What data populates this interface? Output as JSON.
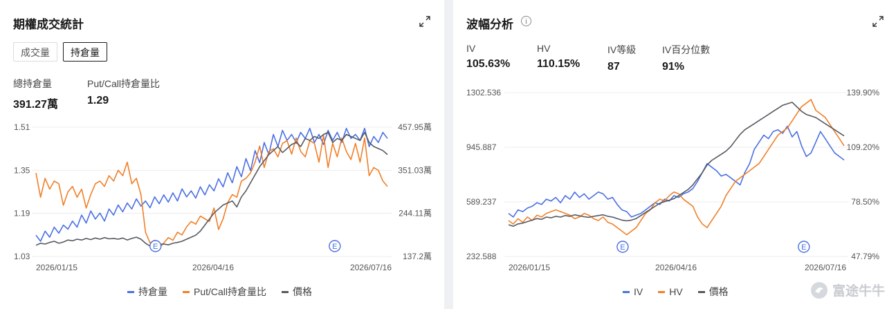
{
  "left": {
    "title": "期權成交統計",
    "tabs": [
      {
        "label": "成交量",
        "active": false
      },
      {
        "label": "持倉量",
        "active": true
      }
    ],
    "stats": [
      {
        "label": "總持倉量",
        "value": "391.27萬"
      },
      {
        "label": "Put/Call持倉量比",
        "value": "1.29"
      }
    ],
    "legend": [
      {
        "label": "持倉量",
        "color": "#4a6fe3"
      },
      {
        "label": "Put/Call持倉量比",
        "color": "#f07f28"
      },
      {
        "label": "價格",
        "color": "#55585e"
      }
    ],
    "event_marker": "E"
  },
  "right": {
    "title": "波幅分析",
    "info_icon": "i",
    "stats": [
      {
        "label": "IV",
        "value": "105.63%"
      },
      {
        "label": "HV",
        "value": "110.15%"
      },
      {
        "label": "IV等級",
        "value": "87"
      },
      {
        "label": "IV百分位數",
        "value": "91%"
      }
    ],
    "legend": [
      {
        "label": "IV",
        "color": "#4a6fe3"
      },
      {
        "label": "HV",
        "color": "#f07f28"
      },
      {
        "label": "價格",
        "color": "#55585e"
      }
    ],
    "event_marker": "E"
  },
  "watermark": "富途牛牛",
  "chart_data": [
    {
      "type": "line",
      "x": [
        "2026/01/15",
        "2026/04/16",
        "2026/07/16"
      ],
      "y_left_ticks": [
        "1.51",
        "1.35",
        "1.19",
        "1.03"
      ],
      "y_right_ticks": [
        "457.95萬",
        "351.03萬",
        "244.11萬",
        "137.2萬"
      ],
      "ylim_left": [
        1.03,
        1.51
      ],
      "ylim_right": [
        137.2,
        457.95
      ],
      "grid": true,
      "legend": "bottom",
      "events": [
        0.34,
        0.85
      ],
      "series": [
        {
          "name": "持倉量",
          "axis": "right",
          "color": "#4a6fe3",
          "values": [
            190,
            175,
            200,
            185,
            210,
            195,
            215,
            205,
            225,
            210,
            240,
            220,
            250,
            230,
            245,
            225,
            255,
            240,
            265,
            248,
            270,
            255,
            280,
            262,
            275,
            258,
            285,
            268,
            290,
            272,
            295,
            275,
            305,
            285,
            300,
            282,
            310,
            290,
            315,
            300,
            330,
            310,
            345,
            320,
            360,
            335,
            380,
            350,
            400,
            370,
            420,
            390,
            440,
            410,
            450,
            425,
            440,
            420,
            445,
            430,
            455,
            420,
            440,
            415,
            450,
            425,
            445,
            420,
            455,
            430,
            440,
            425,
            455,
            410,
            435,
            420,
            445,
            430
          ]
        },
        {
          "name": "Put/Call持倉量比",
          "axis": "left",
          "color": "#f07f28",
          "values": [
            1.34,
            1.25,
            1.32,
            1.28,
            1.31,
            1.3,
            1.22,
            1.27,
            1.29,
            1.25,
            1.28,
            1.21,
            1.26,
            1.3,
            1.31,
            1.29,
            1.33,
            1.31,
            1.35,
            1.33,
            1.38,
            1.3,
            1.32,
            1.26,
            1.12,
            1.08,
            1.09,
            1.06,
            1.08,
            1.1,
            1.09,
            1.12,
            1.11,
            1.14,
            1.16,
            1.15,
            1.18,
            1.17,
            1.16,
            1.21,
            1.13,
            1.17,
            1.23,
            1.26,
            1.25,
            1.31,
            1.32,
            1.34,
            1.38,
            1.44,
            1.36,
            1.42,
            1.43,
            1.4,
            1.45,
            1.46,
            1.41,
            1.47,
            1.42,
            1.4,
            1.46,
            1.45,
            1.38,
            1.48,
            1.36,
            1.45,
            1.4,
            1.47,
            1.42,
            1.39,
            1.45,
            1.38,
            1.47,
            1.33,
            1.36,
            1.35,
            1.31,
            1.29
          ]
        },
        {
          "name": "價格",
          "axis": "right",
          "color": "#55585e",
          "values": [
            165,
            170,
            168,
            172,
            175,
            170,
            173,
            178,
            176,
            180,
            178,
            182,
            179,
            183,
            180,
            184,
            181,
            182,
            180,
            183,
            178,
            182,
            185,
            180,
            170,
            163,
            165,
            167,
            168,
            166,
            170,
            172,
            175,
            180,
            185,
            190,
            200,
            215,
            230,
            245,
            255,
            265,
            270,
            275,
            260,
            285,
            300,
            320,
            340,
            360,
            375,
            390,
            400,
            410,
            395,
            405,
            415,
            420,
            410,
            430,
            425,
            435,
            430,
            440,
            445,
            420,
            430,
            425,
            440,
            435,
            430,
            425,
            445,
            420,
            410,
            405,
            400,
            390
          ]
        }
      ]
    },
    {
      "type": "line",
      "x": [
        "2026/01/15",
        "2026/04/16",
        "2026/07/16"
      ],
      "y_left_ticks": [
        "1302.536",
        "945.887",
        "589.237",
        "232.588"
      ],
      "y_right_ticks": [
        "139.90%",
        "109.20%",
        "78.50%",
        "47.79%"
      ],
      "ylim_left": [
        232.588,
        1302.536
      ],
      "ylim_right": [
        47.79,
        139.9
      ],
      "grid": true,
      "legend": "bottom",
      "events": [
        0.34,
        0.88
      ],
      "series": [
        {
          "name": "IV",
          "axis": "right",
          "color": "#4a6fe3",
          "values": [
            72,
            70,
            74,
            73,
            75,
            76,
            78,
            77,
            80,
            79,
            81,
            78,
            82,
            80,
            84,
            81,
            83,
            80,
            82,
            84,
            83,
            80,
            81,
            77,
            74,
            73,
            70,
            71,
            72,
            74,
            76,
            78,
            77,
            80,
            79,
            82,
            81,
            83,
            84,
            86,
            90,
            95,
            100,
            98,
            96,
            93,
            94,
            92,
            90,
            88,
            95,
            100,
            108,
            112,
            116,
            114,
            118,
            119,
            117,
            121,
            115,
            118,
            110,
            104,
            106,
            112,
            118,
            114,
            110,
            106,
            104,
            102
          ]
        },
        {
          "name": "HV",
          "axis": "right",
          "color": "#f07f28",
          "values": [
            68,
            66,
            69,
            67,
            70,
            68,
            71,
            70,
            72,
            73,
            74,
            73,
            72,
            71,
            69,
            70,
            72,
            71,
            69,
            68,
            70,
            67,
            66,
            64,
            62,
            60,
            62,
            64,
            68,
            72,
            74,
            78,
            80,
            79,
            82,
            84,
            83,
            80,
            78,
            76,
            70,
            66,
            64,
            68,
            72,
            76,
            82,
            86,
            90,
            92,
            94,
            96,
            98,
            100,
            104,
            108,
            112,
            116,
            118,
            120,
            124,
            128,
            132,
            134,
            136,
            130,
            128,
            126,
            122,
            118,
            114,
            110
          ]
        },
        {
          "name": "價格",
          "axis": "left",
          "color": "#55585e",
          "values": [
            440,
            430,
            445,
            450,
            460,
            470,
            480,
            475,
            490,
            485,
            495,
            490,
            500,
            495,
            505,
            498,
            492,
            488,
            495,
            500,
            505,
            495,
            490,
            480,
            470,
            465,
            470,
            480,
            500,
            520,
            540,
            560,
            580,
            590,
            600,
            610,
            630,
            650,
            670,
            700,
            740,
            780,
            830,
            860,
            880,
            900,
            920,
            950,
            990,
            1030,
            1060,
            1080,
            1100,
            1120,
            1140,
            1160,
            1180,
            1200,
            1220,
            1230,
            1240,
            1210,
            1180,
            1160,
            1150,
            1140,
            1120,
            1100,
            1080,
            1060,
            1040,
            1020
          ]
        }
      ]
    }
  ]
}
